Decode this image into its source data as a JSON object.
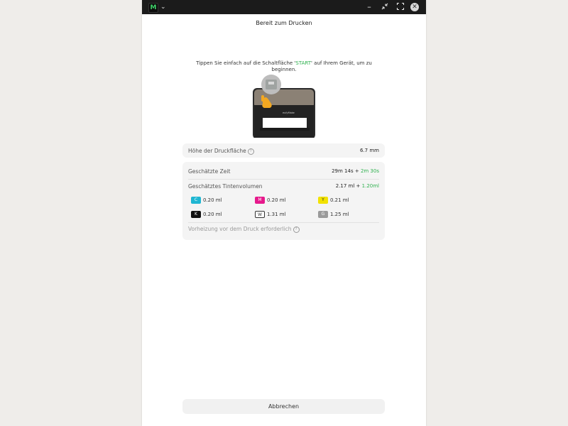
{
  "titlebar": {
    "logo_letter": "M"
  },
  "dialog": {
    "title": "Bereit zum Drucken",
    "instruction": {
      "prefix": "Tippen Sie einfach auf die Schaltfläche '",
      "start": "START",
      "suffix": "' auf Ihrem Gerät, um zu beginnen."
    },
    "device_brand": "eufyMake"
  },
  "print_surface": {
    "label": "Höhe der Druckfläche",
    "value": "6.7 mm"
  },
  "estimates": {
    "time_label": "Geschätzte Zeit",
    "time_value": "29m 14s",
    "time_separator": " + ",
    "time_extra": "2m 30s",
    "ink_label": "Geschätztes Tintenvolumen",
    "ink_value": "2.17 ml",
    "ink_separator": " + ",
    "ink_extra": "1.20ml",
    "inks": [
      {
        "code": "C",
        "value": "0.20 ml",
        "color": "#1fb6d2"
      },
      {
        "code": "M",
        "value": "0.20 ml",
        "color": "#e6198c"
      },
      {
        "code": "Y",
        "value": "0.21 ml",
        "color": "#f2e200"
      },
      {
        "code": "K",
        "value": "0.20 ml",
        "color": "#111111"
      },
      {
        "code": "W",
        "value": "1.31 ml",
        "color": "#ffffff"
      },
      {
        "code": "G",
        "value": "1.25 ml",
        "color": "#9a9a9a"
      }
    ],
    "preheat_note": "Vorheizung vor dem Druck erforderlich"
  },
  "actions": {
    "cancel_label": "Abbrechen"
  }
}
